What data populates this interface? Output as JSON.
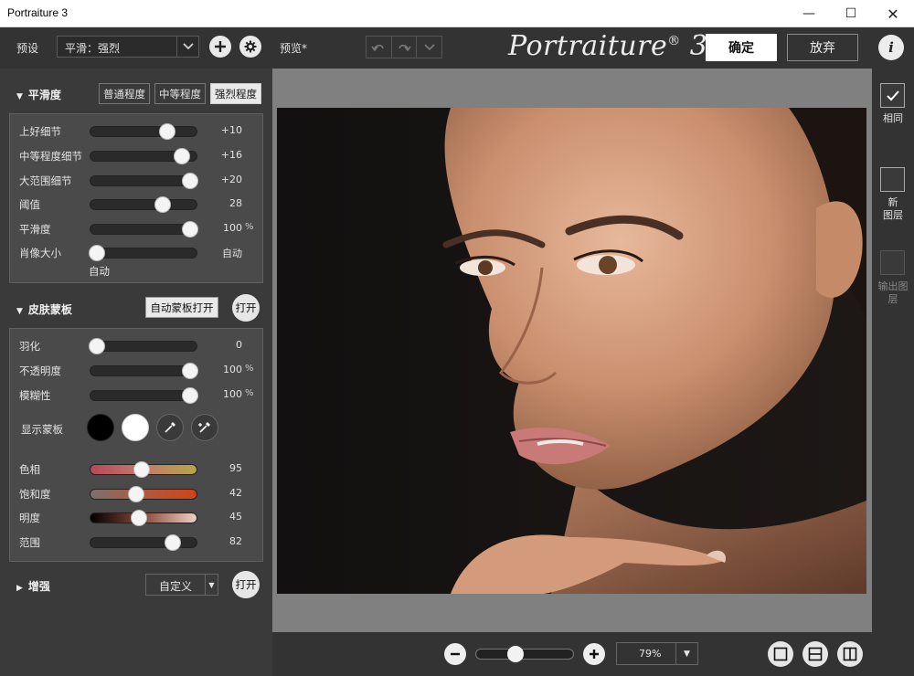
{
  "window": {
    "title": "Portraiture 3",
    "min_glyph": "—",
    "max_glyph": "☐",
    "close_glyph": "✕"
  },
  "toolbar": {
    "preset_label": "预设",
    "preset_value": "平滑：强烈",
    "preview_label": "预览*",
    "logo_text": "Portraiture",
    "logo_mark": "®",
    "logo_version": "3",
    "ok_label": "确定",
    "cancel_label": "放弃",
    "info_label": "i"
  },
  "smoothing": {
    "title": "平滑度",
    "modes": [
      "普通程度",
      "中等程度",
      "强烈程度"
    ],
    "active_mode": "强烈程度",
    "sliders": [
      {
        "name": "上好细节",
        "value": "+10",
        "unit": "",
        "fraction": 0.72
      },
      {
        "name": "中等程度细节",
        "value": "+16",
        "unit": "",
        "fraction": 0.86
      },
      {
        "name": "大范围细节",
        "value": "+20",
        "unit": "",
        "fraction": 0.94
      },
      {
        "name": "阈值",
        "value": "28",
        "unit": "",
        "fraction": 0.68
      },
      {
        "name": "平滑度",
        "value": "100",
        "unit": "%",
        "fraction": 0.94
      },
      {
        "name": "肖像大小",
        "value": "自动",
        "unit": "",
        "fraction": 0.06
      }
    ],
    "portrait_size_note": "自动"
  },
  "skin_mask": {
    "title": "皮肤蒙板",
    "auto_mask_label": "自动蒙板打开",
    "toggle_label": "打开",
    "sliders": [
      {
        "name": "羽化",
        "value": "0",
        "unit": "",
        "fraction": 0.06
      },
      {
        "name": "不透明度",
        "value": "100",
        "unit": "%",
        "fraction": 0.94
      },
      {
        "name": "模糊性",
        "value": "100",
        "unit": "%",
        "fraction": 0.94
      }
    ],
    "show_mask_label": "显示蒙板",
    "color_sliders": [
      {
        "name": "色相",
        "value": "95",
        "fraction": 0.48
      },
      {
        "name": "饱和度",
        "value": "42",
        "fraction": 0.43
      },
      {
        "name": "明度",
        "value": "45",
        "fraction": 0.46
      },
      {
        "name": "范围",
        "value": "82",
        "fraction": 0.78
      }
    ]
  },
  "enhance": {
    "title": "增强",
    "preset_value": "自定义",
    "toggle_label": "打开"
  },
  "zoom": {
    "value": "79%",
    "slider_fraction": 0.41
  },
  "right": {
    "same_label": "相同",
    "new_layer_label": "新\n图层",
    "output_layer_label": "输出图\n层"
  },
  "colors": {
    "panel": "#3a3a3a",
    "box": "#4a4a4a",
    "preview_bg": "#808080",
    "accent_white": "#ffffff"
  }
}
